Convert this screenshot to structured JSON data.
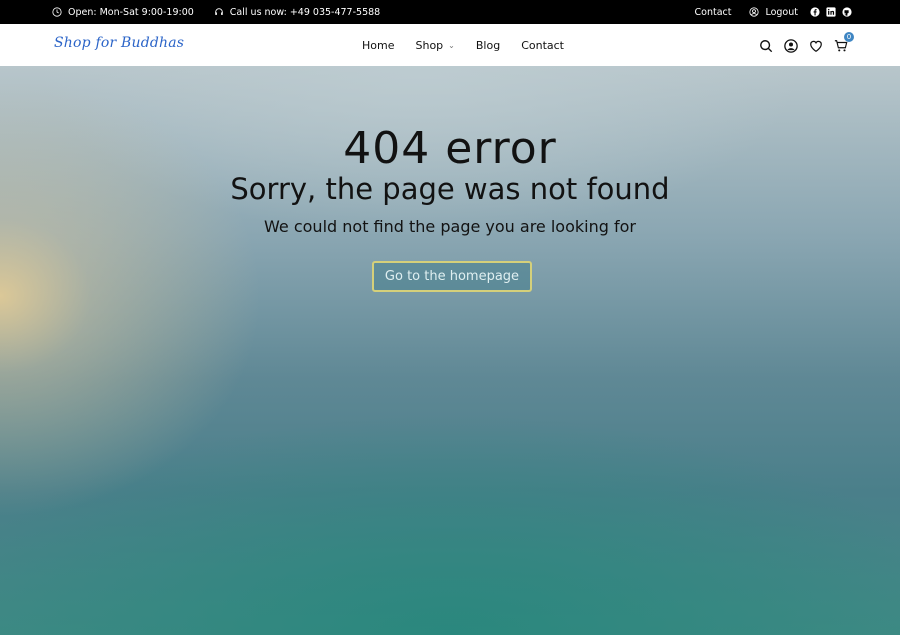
{
  "topbar": {
    "hours": "Open: Mon-Sat 9:00-19:00",
    "phone": "Call us now: +49 035-477-5588",
    "contact": "Contact",
    "logout": "Logout"
  },
  "header": {
    "logo": "Shop for Buddhas",
    "nav": {
      "home": "Home",
      "shop": "Shop",
      "blog": "Blog",
      "contact": "Contact"
    },
    "cart_count": "0"
  },
  "hero": {
    "title": "404 error",
    "subtitle": "Sorry, the page was not found",
    "description": "We could not find the page you are looking for",
    "button_label": "Go to the homepage"
  },
  "colors": {
    "accent": "#3f86c3",
    "topbar": "#000000",
    "button_border": "#d5d07a",
    "logo": "#2b64c8"
  },
  "icons": {
    "topbar_left": [
      "clock-icon",
      "headset-icon"
    ],
    "topbar_right": [
      "user-icon",
      "facebook-icon",
      "linkedin-icon",
      "github-icon"
    ],
    "header_right": [
      "search-icon",
      "account-icon",
      "heart-icon",
      "cart-icon"
    ]
  }
}
